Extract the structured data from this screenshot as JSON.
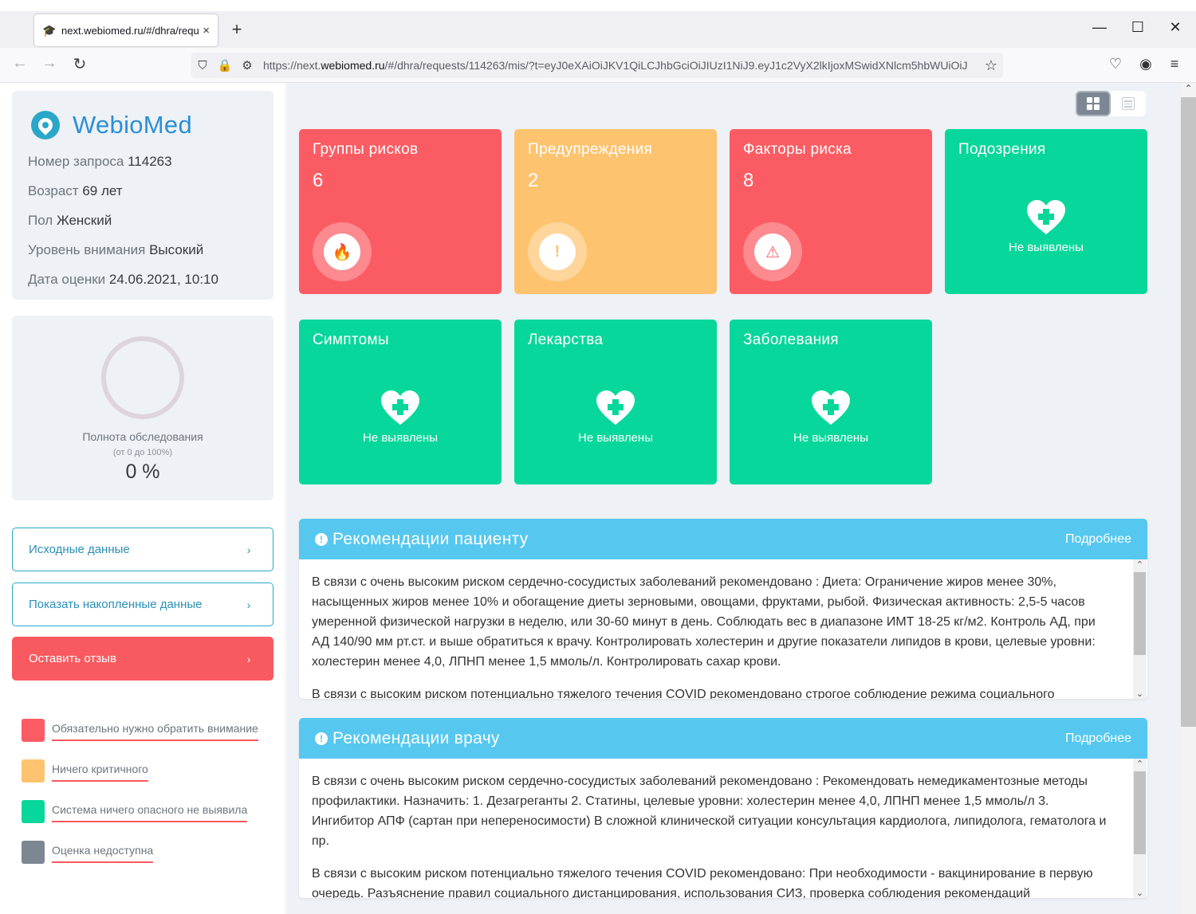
{
  "browser": {
    "tab_title": "next.webiomed.ru/#/dhra/reque",
    "tab_close": "×",
    "new_tab": "+",
    "url_prefix": "https://next.",
    "url_domain": "webiomed.ru",
    "url_rest": "/#/dhra/requests/114263/mis/?t=eyJ0eXAiOiJKV1QiLCJhbGciOiJIUzI1NiJ9.eyJ1c2VyX2lkIjoxMSwidXNlcm5hbWUiOiJ",
    "icons": [
      "back-icon",
      "forward-icon",
      "reload-icon",
      "shield-icon",
      "lock-icon",
      "permissions-icon",
      "star-icon",
      "pocket-icon",
      "account-icon",
      "menu-icon",
      "minimize-icon",
      "maximize-icon",
      "close-icon"
    ]
  },
  "sidebar": {
    "logo_text": "WebioMed",
    "info": [
      {
        "label": "Номер запроса",
        "value": "114263"
      },
      {
        "label": "Возраст",
        "value": "69 лет"
      },
      {
        "label": "Пол",
        "value": "Женский"
      },
      {
        "label": "Уровень внимания",
        "value": "Высокий"
      },
      {
        "label": "Дата оценки",
        "value": "24.06.2021, 10:10"
      }
    ],
    "completeness": {
      "title": "Полнота обследования",
      "range": "(от 0 до 100%)",
      "value": "0 %",
      "fraction": 0
    },
    "buttons": [
      {
        "label": "Исходные данные",
        "chevron": "›"
      },
      {
        "label": "Показать накопленные данные",
        "chevron": "›"
      },
      {
        "label": "Оставить отзыв",
        "chevron": "›"
      }
    ],
    "legend": [
      {
        "label": "Обязательно нужно обратить внимание",
        "color": "#fb5c63"
      },
      {
        "label": "Ничего критичного",
        "color": "#fec36f"
      },
      {
        "label": "Система ничего опасного не выявила",
        "color": "#08d79b"
      },
      {
        "label": "Оценка недоступна",
        "color": "#7d8794"
      }
    ]
  },
  "tiles": [
    {
      "title": "Группы рисков",
      "count": "6",
      "status": "red",
      "icon": "fire-icon"
    },
    {
      "title": "Предупреждения",
      "count": "2",
      "status": "orange",
      "icon": "exclamation-icon"
    },
    {
      "title": "Факторы риска",
      "count": "8",
      "status": "red",
      "icon": "warning-icon"
    },
    {
      "title": "Подозрения",
      "status": "green",
      "note": "Не выявлены",
      "icon": "heart-plus-icon"
    },
    {
      "title": "Симптомы",
      "status": "green",
      "note": "Не выявлены",
      "icon": "heart-plus-icon"
    },
    {
      "title": "Лекарства",
      "status": "green",
      "note": "Не выявлены",
      "icon": "heart-plus-icon"
    },
    {
      "title": "Заболевания",
      "status": "green",
      "note": "Не выявлены",
      "icon": "heart-plus-icon"
    }
  ],
  "recommendations": [
    {
      "title": "Рекомендации пациенту",
      "more": "Подробнее",
      "paragraphs": [
        "В связи с очень высоким риском сердечно-сосудистых заболеваний рекомендовано : Диета: Ограничение жиров менее 30%, насыщенных жиров менее 10% и обогащение диеты зерновыми, овощами, фруктами, рыбой. Физическая активность: 2,5-5 часов умеренной физической нагрузки в неделю, или 30-60 минут в день. Соблюдать вес в диапазоне ИМТ 18-25 кг/м2.  Контроль АД, при АД 140/90 мм рт.ст. и выше обратиться к врачу. Контролировать холестерин и другие показатели липидов в крови, целевые уровни: холестерин менее 4,0, ЛПНП менее 1,5 ммоль/л.  Контролировать сахар крови.",
        "В связи с высоким риском потенциально тяжелого течения COVID рекомендовано строгое соблюдение режима социального"
      ]
    },
    {
      "title": "Рекомендации врачу",
      "more": "Подробнее",
      "paragraphs": [
        "В связи с очень высоким риском сердечно-сосудистых заболеваний рекомендовано : Рекомендовать немедикаментозные методы профилактики. Назначить: 1. Дезагреганты 2. Статины, целевые уровни: холестерин менее 4,0, ЛПНП менее 1,5 ммоль/л 3. Ингибитор АПФ (сартан при непереносимости) В сложной клинической ситуации консультация кардиолога, липидолога, гематолога и пр.",
        "В связи с высоким риском потенциально тяжелого течения COVID рекомендовано: При необходимости - вакцинирование в первую очередь. Разъяснение правил социального дистанцирования, использования СИЗ, проверка соблюдения рекомендаций"
      ]
    }
  ]
}
